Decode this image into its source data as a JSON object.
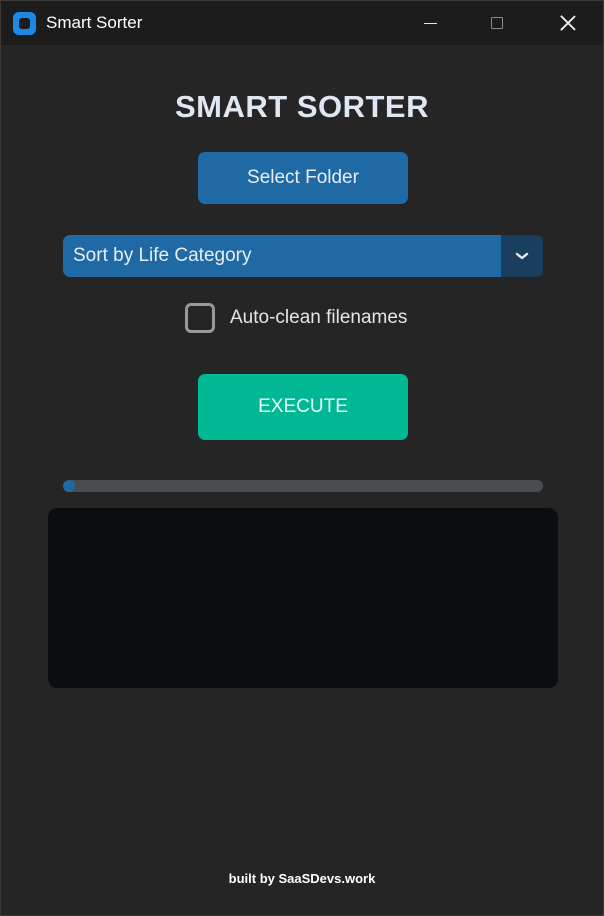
{
  "window": {
    "title": "Smart Sorter",
    "app_icon": "app-logo-icon",
    "controls": [
      "minimize-icon",
      "maximize-icon",
      "close-icon"
    ]
  },
  "main": {
    "heading": "SMART SORTER",
    "select_folder_label": "Select Folder",
    "sort_mode": {
      "selected": "Sort by Life Category",
      "arrow_icon": "chevron-down-icon"
    },
    "auto_clean": {
      "label": "Auto-clean filenames",
      "checked": false
    },
    "execute_label": "EXECUTE",
    "progress": 0,
    "log_text": ""
  },
  "footer": {
    "text": "built by SaaSDevs.work"
  },
  "colors": {
    "background": "#252525",
    "titlebar": "#1c1c1c",
    "primary": "#1f6aa5",
    "dropdown_arrow_bg": "#1a3e5e",
    "execute": "#00b894",
    "progress_track": "#4a4d50",
    "log_background": "#0b0e11",
    "heading_text": "#dfe7f3"
  }
}
